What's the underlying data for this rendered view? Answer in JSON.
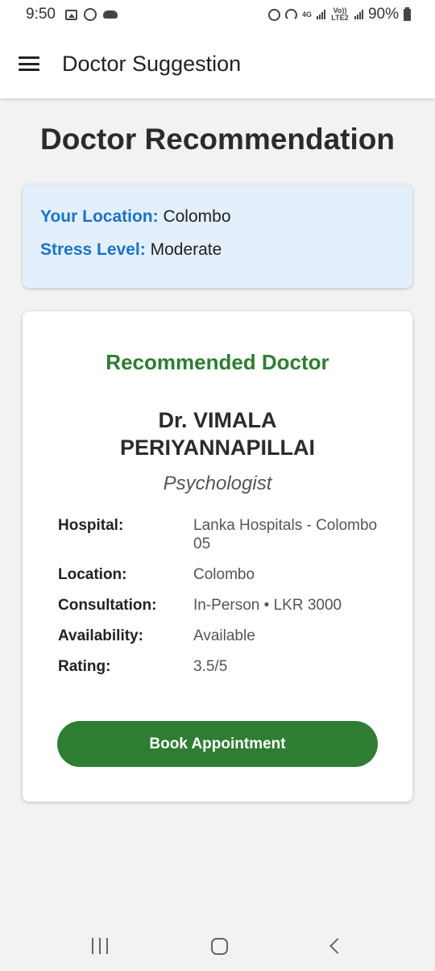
{
  "status_bar": {
    "time": "9:50",
    "network_4g": "4G",
    "volte": "Vo)) LTE2",
    "battery": "90%"
  },
  "app_bar": {
    "title": "Doctor Suggestion"
  },
  "page": {
    "title": "Doctor Recommendation"
  },
  "user_info": {
    "location_label": "Your Location:",
    "location_value": "Colombo",
    "stress_label": "Stress Level:",
    "stress_value": "Moderate"
  },
  "doctor": {
    "heading": "Recommended Doctor",
    "name": "Dr. VIMALA PERIYANNAPILLAI",
    "specialty": "Psychologist",
    "details": [
      {
        "label": "Hospital:",
        "value": "Lanka Hospitals - Colombo 05"
      },
      {
        "label": "Location:",
        "value": "Colombo"
      },
      {
        "label": "Consultation:",
        "value": "In-Person • LKR 3000"
      },
      {
        "label": "Availability:",
        "value": "Available"
      },
      {
        "label": "Rating:",
        "value": "3.5/5"
      }
    ],
    "book_button": "Book Appointment"
  },
  "colors": {
    "accent_green": "#2e7d32",
    "accent_blue": "#1a73c8",
    "info_bg": "#e3effb"
  }
}
